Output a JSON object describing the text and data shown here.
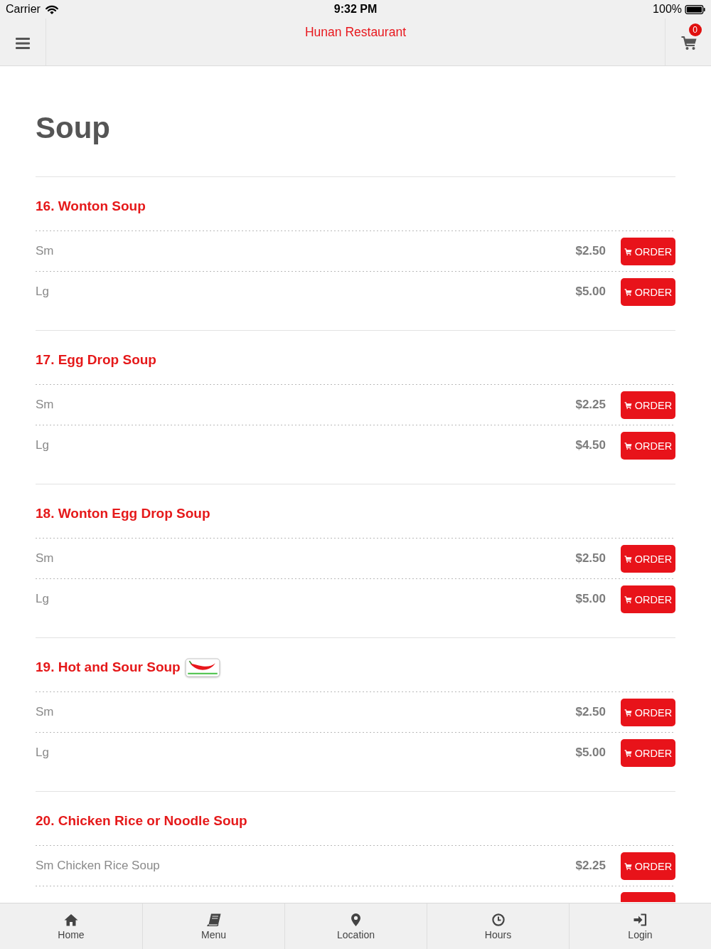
{
  "status_bar": {
    "carrier": "Carrier",
    "time": "9:32 PM",
    "battery": "100%"
  },
  "nav": {
    "title": "Hunan Restaurant",
    "cart_count": "0"
  },
  "category": {
    "title": "Soup"
  },
  "items": [
    {
      "name": "16. Wonton Soup",
      "spicy": false,
      "more_below": false,
      "sizes": [
        {
          "label": "Sm",
          "price": "$2.50",
          "button": "ORDER"
        },
        {
          "label": "Lg",
          "price": "$5.00",
          "button": "ORDER"
        }
      ]
    },
    {
      "name": "17. Egg Drop Soup",
      "spicy": false,
      "more_below": false,
      "sizes": [
        {
          "label": "Sm",
          "price": "$2.25",
          "button": "ORDER"
        },
        {
          "label": "Lg",
          "price": "$4.50",
          "button": "ORDER"
        }
      ]
    },
    {
      "name": "18. Wonton Egg Drop Soup",
      "spicy": false,
      "more_below": false,
      "sizes": [
        {
          "label": "Sm",
          "price": "$2.50",
          "button": "ORDER"
        },
        {
          "label": "Lg",
          "price": "$5.00",
          "button": "ORDER"
        }
      ]
    },
    {
      "name": "19. Hot and Sour Soup",
      "spicy": true,
      "more_below": false,
      "sizes": [
        {
          "label": "Sm",
          "price": "$2.50",
          "button": "ORDER"
        },
        {
          "label": "Lg",
          "price": "$5.00",
          "button": "ORDER"
        }
      ]
    },
    {
      "name": "20. Chicken Rice or Noodle Soup",
      "spicy": false,
      "more_below": true,
      "sizes": [
        {
          "label": "Sm Chicken Rice Soup",
          "price": "$2.25",
          "button": "ORDER"
        }
      ]
    }
  ],
  "tab_bar": [
    {
      "kind": "home",
      "label": "Home"
    },
    {
      "kind": "menu",
      "label": "Menu"
    },
    {
      "kind": "location",
      "label": "Location"
    },
    {
      "kind": "hours",
      "label": "Hours"
    },
    {
      "kind": "login",
      "label": "Login"
    }
  ]
}
